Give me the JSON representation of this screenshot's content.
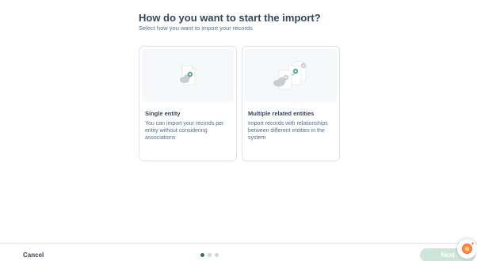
{
  "header": {
    "title": "How do you want to start the import?",
    "subtitle": "Select how you want to import your records"
  },
  "options": [
    {
      "title": "Single entity",
      "description": "You can import your records per entity without considering associations"
    },
    {
      "title": "Multiple related entities",
      "description": "Import records with relationships between different entities in the system"
    }
  ],
  "footer": {
    "cancel_label": "Cancel",
    "next_label": "Next",
    "steps_total": 3,
    "current_step": 1
  },
  "colors": {
    "accent_green": "#4fb285",
    "next_disabled": "#cfe5da",
    "step_active": "#3b6d71"
  },
  "icons": {
    "assistant": "assistant-sparkle-icon"
  }
}
